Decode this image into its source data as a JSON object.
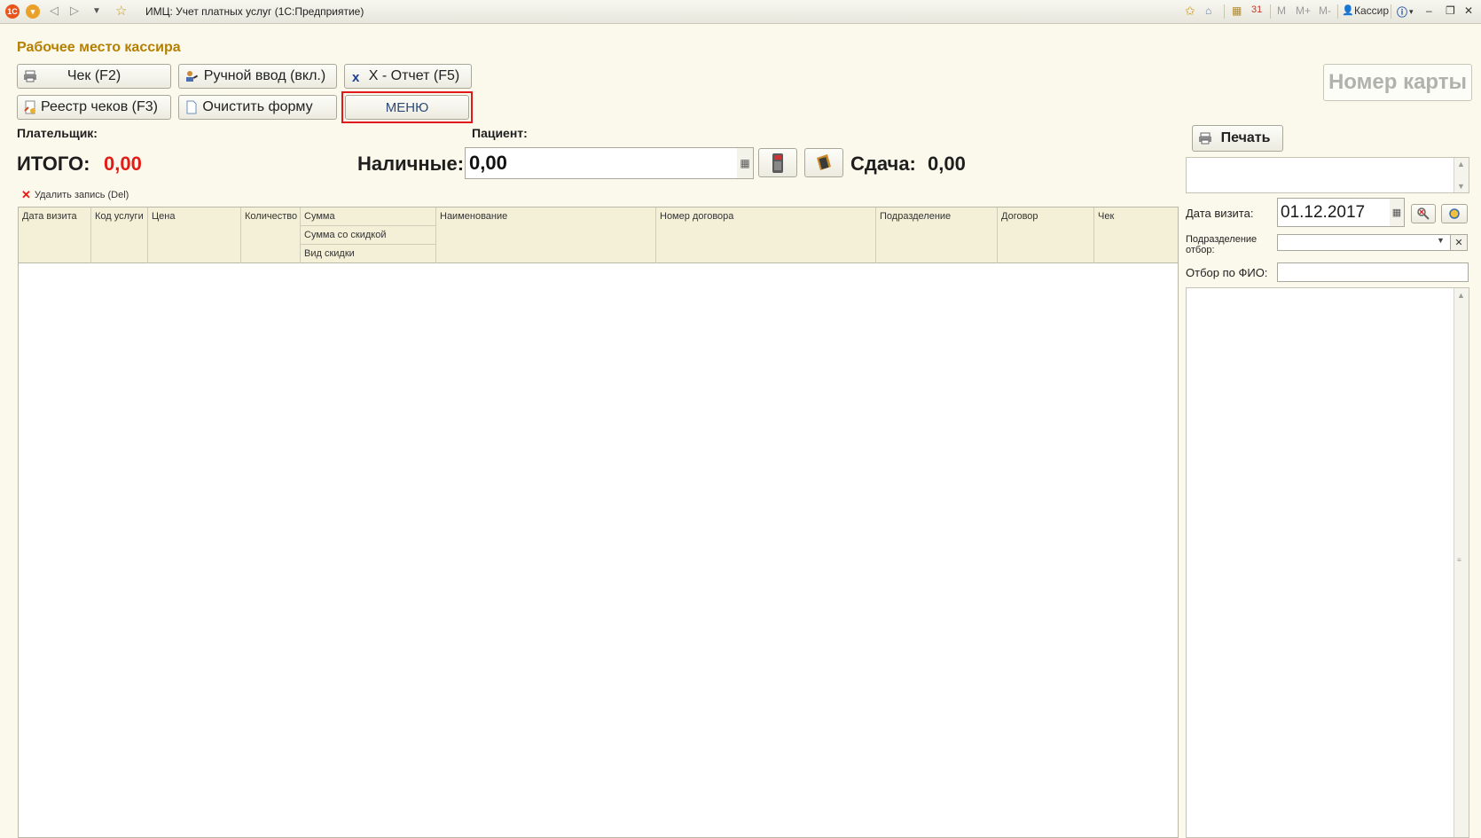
{
  "window": {
    "title": "ИМЦ: Учет платных услуг  (1С:Предприятие)",
    "user": "Кассир",
    "toolbar_right": [
      "M",
      "M+",
      "M-"
    ]
  },
  "page": {
    "title": "Рабочее место кассира"
  },
  "buttons": {
    "check": "Чек (F2)",
    "manual_input": "Ручной ввод (вкл.)",
    "x_report": "X - Отчет (F5)",
    "check_registry": "Реестр чеков (F3)",
    "clear_form": "Очистить форму",
    "menu": "МЕНЮ",
    "print": "Печать"
  },
  "card_number_placeholder": "Номер карты",
  "labels": {
    "payer": "Плательщик:",
    "patient": "Пациент:",
    "total": "ИТОГО:",
    "cash": "Наличные:",
    "change": "Сдача:",
    "delete_record": "Удалить запись (Del)",
    "visit_date": "Дата визита:",
    "department_filter": "Подразделение отбор:",
    "fio_filter": "Отбор по ФИО:"
  },
  "values": {
    "total": "0,00",
    "cash": "0,00",
    "change": "0,00",
    "visit_date": "01.12.2017"
  },
  "table": {
    "columns": [
      "Дата визита",
      "Код услуги",
      "Цена",
      "Количество",
      "Сумма",
      "Наименование",
      "Номер договора",
      "Подразделение",
      "Договор",
      "Чек"
    ],
    "sum_subcolumns": [
      "Сумма со скидкой",
      "Вид скидки"
    ]
  },
  "colors": {
    "title": "#b57f00",
    "total_value": "#e41b17",
    "highlight_frame": "#e1191b",
    "background": "#fbf9ec"
  }
}
